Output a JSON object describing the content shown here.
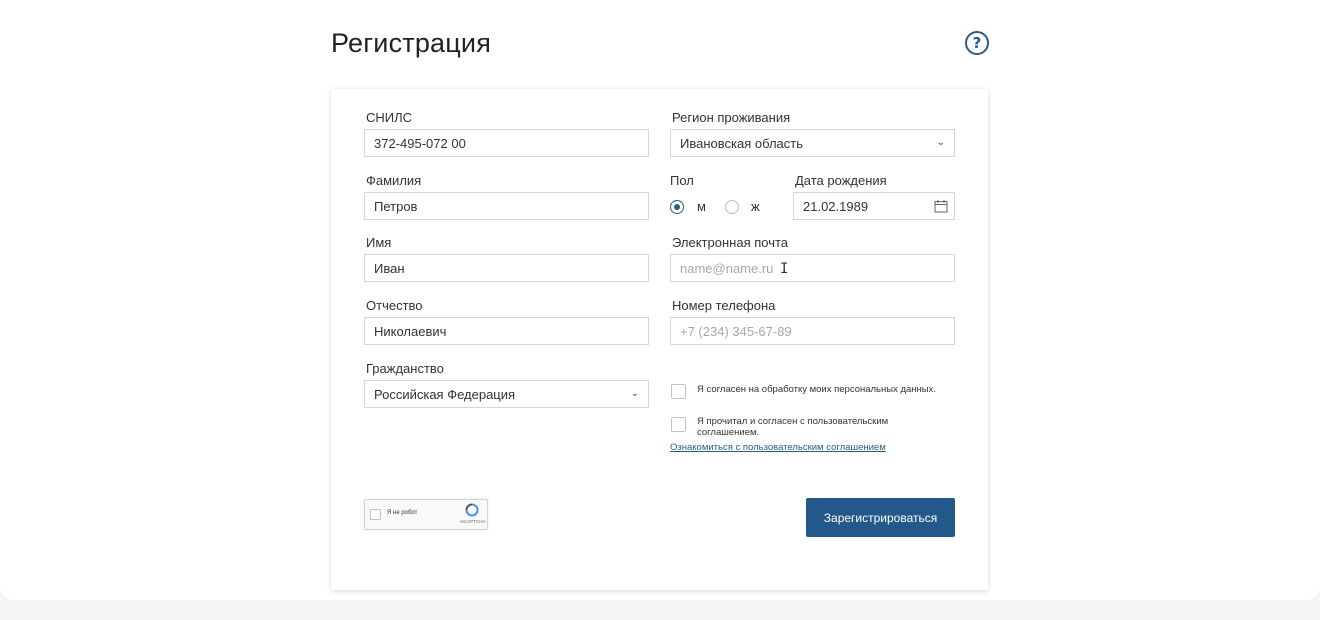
{
  "page": {
    "title": "Регистрация",
    "help_symbol": "?"
  },
  "form": {
    "snils": {
      "label": "СНИЛС",
      "value": "372-495-072 00"
    },
    "region": {
      "label": "Регион проживания",
      "value": "Ивановская область"
    },
    "surname": {
      "label": "Фамилия",
      "value": "Петров"
    },
    "gender": {
      "label": "Пол",
      "options": [
        {
          "label": "м",
          "selected": true
        },
        {
          "label": "ж",
          "selected": false
        }
      ]
    },
    "birthdate": {
      "label": "Дата рождения",
      "value": "21.02.1989"
    },
    "name": {
      "label": "Имя",
      "value": "Иван"
    },
    "email": {
      "label": "Электронная почта",
      "value": "",
      "placeholder": "name@name.ru"
    },
    "patronymic": {
      "label": "Отчество",
      "value": "Николаевич"
    },
    "phone": {
      "label": "Номер телефона",
      "value": "",
      "placeholder": "+7 (234) 345-67-89"
    },
    "citizenship": {
      "label": "Гражданство",
      "value": "Российская Федерация"
    },
    "consent_personal": {
      "text": "Я согласен на обработку моих персональных данных.",
      "checked": false
    },
    "consent_agreement": {
      "text": "Я прочитал и согласен с пользовательским соглашением.",
      "checked": false
    },
    "agreement_link": "Ознакомиться с пользовательским соглашением",
    "captcha": {
      "label": "Я не робот",
      "brand": "reCAPTCHA"
    },
    "submit_label": "Зарегистрироваться"
  },
  "colors": {
    "accent": "#23598a",
    "border": "#d4d6d9",
    "placeholder": "#a4a8ad"
  }
}
